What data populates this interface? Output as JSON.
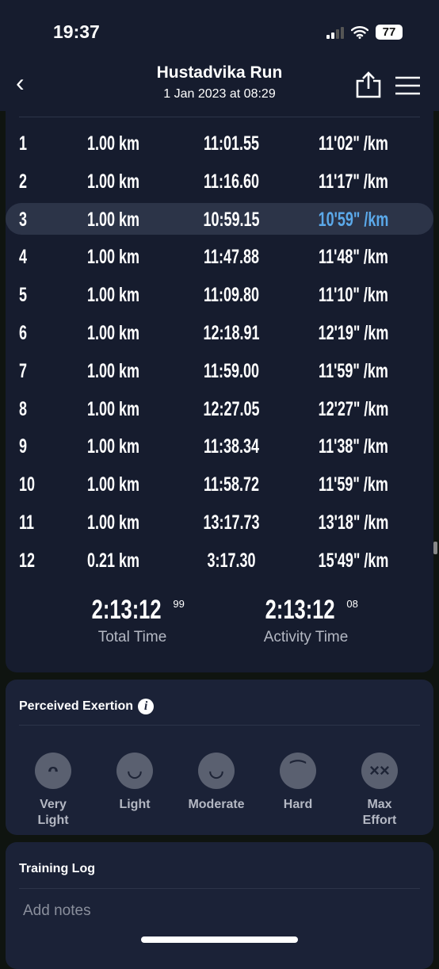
{
  "status": {
    "time": "19:37",
    "battery": "77"
  },
  "header": {
    "title": "Hustadvika Run",
    "subtitle": "1 Jan 2023 at 08:29"
  },
  "laps": [
    {
      "n": "1",
      "dist": "1.00 km",
      "time": "11:01.55",
      "pace": "11'02\" /km"
    },
    {
      "n": "2",
      "dist": "1.00 km",
      "time": "11:16.60",
      "pace": "11'17\" /km"
    },
    {
      "n": "3",
      "dist": "1.00 km",
      "time": "10:59.15",
      "pace": "10'59\" /km",
      "highlight": true
    },
    {
      "n": "4",
      "dist": "1.00 km",
      "time": "11:47.88",
      "pace": "11'48\" /km"
    },
    {
      "n": "5",
      "dist": "1.00 km",
      "time": "11:09.80",
      "pace": "11'10\" /km"
    },
    {
      "n": "6",
      "dist": "1.00 km",
      "time": "12:18.91",
      "pace": "12'19\" /km"
    },
    {
      "n": "7",
      "dist": "1.00 km",
      "time": "11:59.00",
      "pace": "11'59\" /km"
    },
    {
      "n": "8",
      "dist": "1.00 km",
      "time": "12:27.05",
      "pace": "12'27\" /km"
    },
    {
      "n": "9",
      "dist": "1.00 km",
      "time": "11:38.34",
      "pace": "11'38\" /km"
    },
    {
      "n": "10",
      "dist": "1.00 km",
      "time": "11:58.72",
      "pace": "11'59\" /km"
    },
    {
      "n": "11",
      "dist": "1.00 km",
      "time": "13:17.73",
      "pace": "13'18\" /km"
    },
    {
      "n": "12",
      "dist": "0.21 km",
      "time": "3:17.30",
      "pace": "15'49\" /km"
    }
  ],
  "totals": {
    "total_time": "2:13:12",
    "total_time_frac": "99",
    "total_label": "Total Time",
    "activity_time": "2:13:12",
    "activity_time_frac": "08",
    "activity_label": "Activity Time"
  },
  "exertion": {
    "title": "Perceived Exertion",
    "options": [
      {
        "label": "Very Light",
        "icon": "laughing-face-icon"
      },
      {
        "label": "Light",
        "icon": "grinning-face-icon"
      },
      {
        "label": "Moderate",
        "icon": "smiling-face-icon"
      },
      {
        "label": "Hard",
        "icon": "strained-face-icon"
      },
      {
        "label": "Max Effort",
        "icon": "dizzy-face-icon"
      }
    ]
  },
  "training_log": {
    "title": "Training Log",
    "placeholder": "Add notes"
  },
  "colors": {
    "highlight_pace": "#5ba9ea",
    "background": "#161c2e"
  }
}
